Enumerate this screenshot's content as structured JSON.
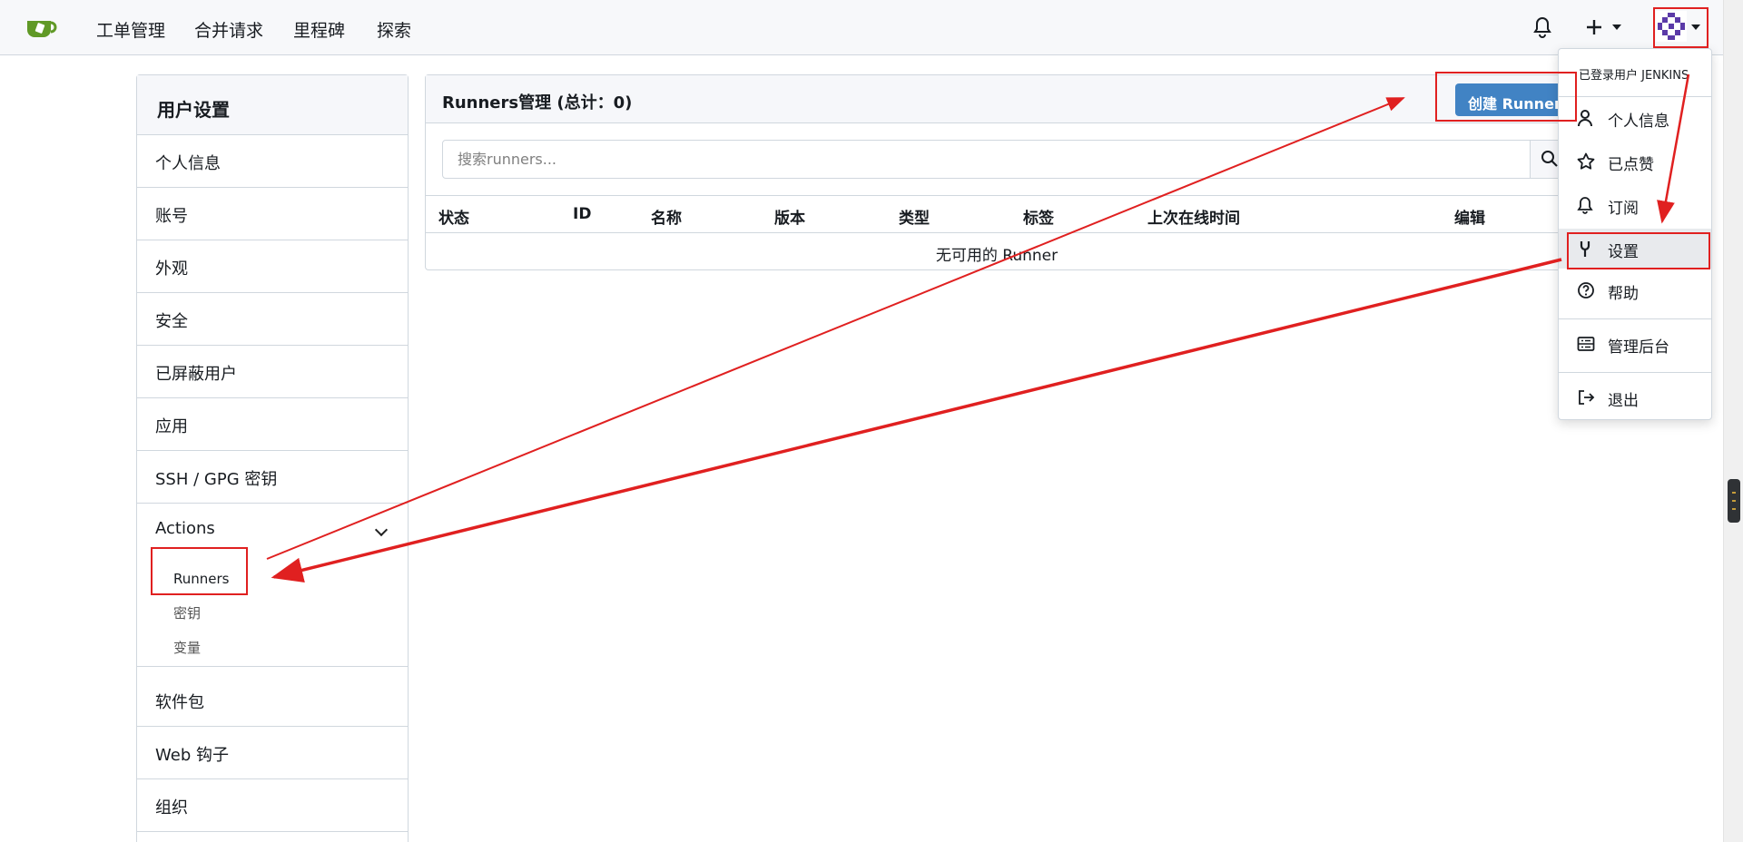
{
  "nav": {
    "links": [
      "工单管理",
      "合并请求",
      "里程碑",
      "探索"
    ],
    "icons": [
      "tea-logo-icon",
      "bell-icon",
      "plus-icon",
      "avatar"
    ]
  },
  "sidebar": {
    "title": "用户设置",
    "items": [
      "个人信息",
      "账号",
      "外观",
      "安全",
      "已屏蔽用户",
      "应用",
      "SSH / GPG 密钥"
    ],
    "actions": {
      "label": "Actions",
      "sub": [
        "Runners",
        "密钥",
        "变量"
      ]
    },
    "items_after": [
      "软件包",
      "Web 钩子",
      "组织"
    ]
  },
  "main": {
    "title": "Runners管理 (总计：0)",
    "create_button": "创建 Runner",
    "search_placeholder": "搜索runners...",
    "columns": [
      "状态",
      "ID",
      "名称",
      "版本",
      "类型",
      "标签",
      "上次在线时间",
      "编辑"
    ],
    "empty_text": "无可用的 Runner"
  },
  "dropdown": {
    "header": "已登录用户 JENKINS",
    "items": [
      {
        "label": "个人信息",
        "icon": "person-icon"
      },
      {
        "label": "已点赞",
        "icon": "star-icon"
      },
      {
        "label": "订阅",
        "icon": "bell-icon"
      },
      {
        "label": "设置",
        "icon": "tool-icon"
      },
      {
        "label": "帮助",
        "icon": "question-icon"
      },
      {
        "label": "管理后台",
        "icon": "server-icon"
      },
      {
        "label": "退出",
        "icon": "sign-out-icon"
      }
    ],
    "active": "设置"
  },
  "colors": {
    "accent": "#4183c4",
    "annotation": "#e02020",
    "logo": "#609926"
  }
}
